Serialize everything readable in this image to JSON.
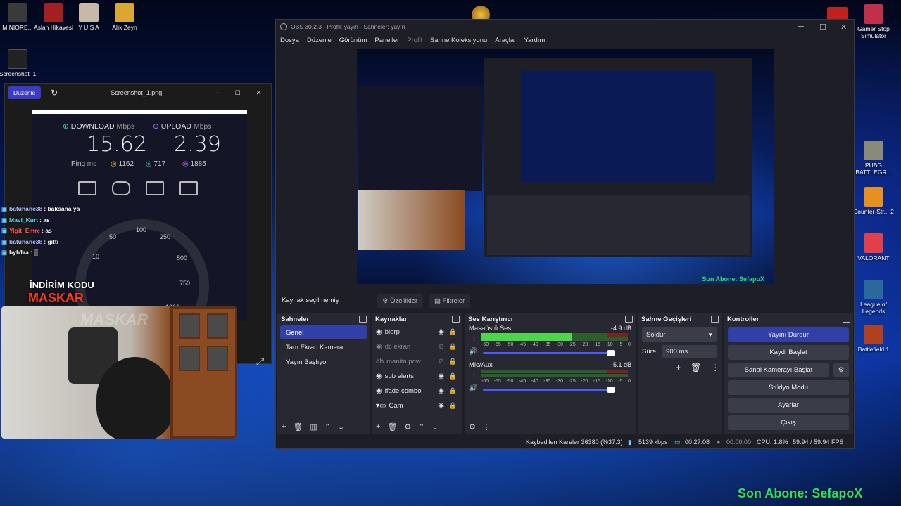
{
  "desktop_icons_left": [
    {
      "label": "MİNİORE...",
      "color": "#3a3a3a"
    },
    {
      "label": "Aslan Hikayesi",
      "color": "#a32020"
    },
    {
      "label": "Y U Ş A",
      "color": "#c8b8a8"
    },
    {
      "label": "Alık Zeyn",
      "color": "#d8a830"
    }
  ],
  "desktop_icon_screenshot": "Screenshot_1",
  "desktop_icons_right": [
    {
      "label": "Gamer Stop Simulator",
      "color": "#c0304a"
    },
    {
      "label": "PUBG BATTLEGR...",
      "color": "#8a8a7a"
    },
    {
      "label": "Counter-Str... 2",
      "color": "#e69020"
    },
    {
      "label": "VALORANT",
      "color": "#e0404a"
    },
    {
      "label": "League of Legends",
      "color": "#2a6a9a"
    },
    {
      "label": "Battlefield 1",
      "color": "#b04020"
    }
  ],
  "photo_viewer": {
    "edit_label": "Düzenle",
    "filename": "Screenshot_1.png",
    "more": "···"
  },
  "speedtest": {
    "download_label": "DOWNLOAD",
    "upload_label": "UPLOAD",
    "unit": "Mbps",
    "download_value": "15.62",
    "upload_value": "2.39",
    "ping_label": "Ping",
    "ping_unit": "ms",
    "ping_idle": "1162",
    "ping_down": "717",
    "ping_up": "1885",
    "gauge_labels": [
      "10",
      "50",
      "100",
      "250",
      "500",
      "750",
      "1000"
    ],
    "gauge_reading": "0.00"
  },
  "chat": [
    {
      "user": "batuhanc38",
      "msg": ": baksana ya",
      "color": "#a8b8ff"
    },
    {
      "user": "Mavi_Kurt",
      "msg": ": as",
      "color": "#5ee0ff"
    },
    {
      "user": "Yigit_Emre",
      "msg": ": as",
      "color": "#ff5a5a"
    },
    {
      "user": "batuhanc38",
      "msg": ": gitti",
      "color": "#a8b8ff"
    },
    {
      "user": "byh1ra",
      "msg": ": ▒",
      "color": "#ffffff"
    }
  ],
  "promo": {
    "title": "İNDİRİM KODU",
    "code": "MASKAR",
    "watermark": "MASKAR"
  },
  "last_sub": "Son Abone: SefapoX",
  "obs": {
    "title": "OBS 30.2.3 - Profil: yayın - Sahneler: yayın",
    "menu": [
      "Dosya",
      "Düzenle",
      "Görünüm",
      "Paneller",
      "Profil",
      "Sahne Koleksiyonu",
      "Araçlar",
      "Yardım"
    ],
    "no_source": "Kaynak seçilmemiş",
    "properties": "Özellikler",
    "filters": "Filtreler",
    "scenes_title": "Sahneler",
    "scenes": [
      "Genel",
      "Tam Ekran Kamera",
      "Yayın Başlıyor"
    ],
    "sources_title": "Kaynaklar",
    "sources": [
      {
        "name": "blerp",
        "visible": true,
        "locked": true,
        "dim": false
      },
      {
        "name": "dc ekran",
        "visible": false,
        "locked": false,
        "dim": true
      },
      {
        "name": "manita pow",
        "visible": false,
        "locked": false,
        "dim": true
      },
      {
        "name": "sub alerts",
        "visible": true,
        "locked": true,
        "dim": false
      },
      {
        "name": "ifade combo",
        "visible": true,
        "locked": true,
        "dim": false
      },
      {
        "name": "Cam",
        "visible": true,
        "locked": false,
        "dim": false
      }
    ],
    "mixer_title": "Ses Karıştırıcı",
    "mixer": [
      {
        "name": "Masaüstü Ses",
        "db": "-4.9 dB",
        "level": 0.62,
        "volume": 0.93
      },
      {
        "name": "Mic/Aux",
        "db": "-5.1 dB",
        "level": 0.0,
        "volume": 0.93
      }
    ],
    "mixer_scale": [
      "-60",
      "-55",
      "-50",
      "-45",
      "-40",
      "-35",
      "-30",
      "-25",
      "-20",
      "-15",
      "-10",
      "-5",
      "0"
    ],
    "transitions_title": "Sahne Geçişleri",
    "transition": "Soldur",
    "duration_label": "Süre",
    "duration": "900 ms",
    "controls_title": "Kontroller",
    "controls": [
      "Yayını Durdur",
      "Kaydı Başlat",
      "Sanal Kamerayı Başlat",
      "Stüdyo Modu",
      "Ayarlar",
      "Çıkış"
    ],
    "status": {
      "dropped": "Kaybedilen Kareler 36380 (%37.3)",
      "bitrate": "5139 kbps",
      "stream_time": "00:27:08",
      "rec_time": "00:00:00",
      "cpu": "CPU: 1.8%",
      "fps": "59.94 / 59.94 FPS"
    }
  }
}
